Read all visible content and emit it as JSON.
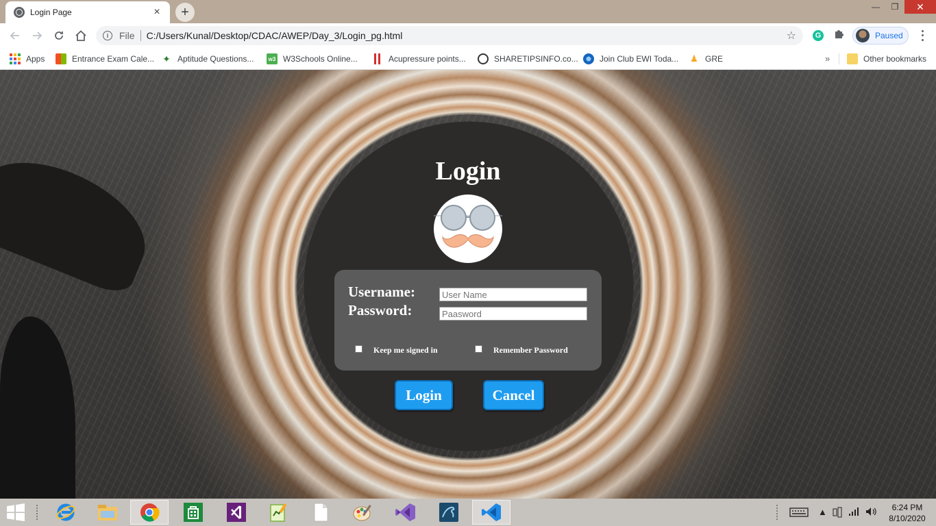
{
  "browser": {
    "tab_title": "Login Page",
    "tab_close": "×",
    "new_tab": "+",
    "window_controls": {
      "minimize": "—",
      "maximize": "❐",
      "close": "✕"
    },
    "scheme_label": "File",
    "url": "C:/Users/Kunal/Desktop/CDAC/AWEP/Day_3/Login_pg.html",
    "profile_status": "Paused",
    "grammarly_letter": "G",
    "bookmarks": [
      {
        "label": "Apps",
        "icon": "apps-grid-icon"
      },
      {
        "label": "Entrance Exam Cale...",
        "icon": "windows-tiles-icon"
      },
      {
        "label": "Aptitude Questions...",
        "icon": "palm-tree-icon"
      },
      {
        "label": "W3Schools Online...",
        "icon": "w3schools-icon"
      },
      {
        "label": "Acupressure points...",
        "icon": "red-bars-icon"
      },
      {
        "label": "SHARETIPSINFO.co...",
        "icon": "swirl-icon"
      },
      {
        "label": "Join Club EWI Toda...",
        "icon": "globe-icon"
      },
      {
        "label": "GRE",
        "icon": "person-icon"
      }
    ],
    "other_bookmarks": "Other bookmarks",
    "bookmarks_overflow": "»"
  },
  "login": {
    "title": "Login",
    "username_label": "Username:",
    "username_placeholder": "User Name",
    "password_label": "Password:",
    "password_placeholder": "Paasword",
    "keep_signed_in": "Keep me signed in",
    "remember_password": "Remember Password",
    "login_button": "Login",
    "cancel_button": "Cancel"
  },
  "taskbar": {
    "apps": [
      "internet-explorer-icon",
      "file-explorer-icon",
      "chrome-icon",
      "store-icon",
      "visual-studio-icon",
      "notepad-plus-icon",
      "blank-file-icon",
      "paint-icon",
      "visual-studio-purple-icon",
      "mysql-workbench-icon",
      "vscode-icon"
    ],
    "time": "6:24 PM",
    "date": "8/10/2020"
  },
  "colors": {
    "button_blue": "#1e9cf0",
    "panel_gray": "#5f5f5f",
    "chrome_tabstrip": "#b9a999",
    "close_red": "#c7382e"
  }
}
